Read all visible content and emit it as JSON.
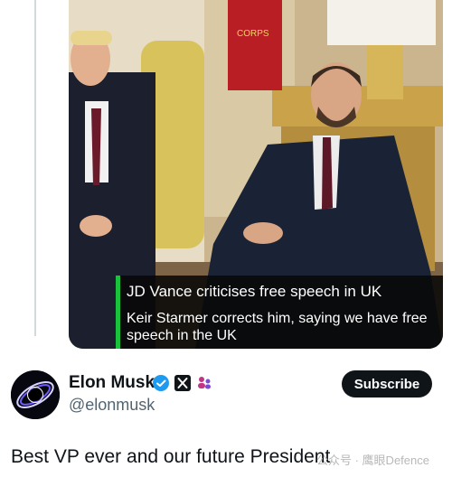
{
  "video": {
    "caption_headline": "JD Vance criticises free speech in UK",
    "caption_body": "Keir Starmer corrects him, saying we have free speech in the UK",
    "accent_color": "#19c23a"
  },
  "author": {
    "display_name": "Elon Musk",
    "handle": "@elonmusk",
    "badges": [
      "verified-check-icon",
      "x-logo-icon",
      "affiliation-people-icon"
    ],
    "verified_color": "#1d9bf0"
  },
  "actions": {
    "subscribe_label": "Subscribe"
  },
  "post": {
    "text": "Best VP ever and our future President"
  },
  "watermark": {
    "text": "公众号 · 鹰眼Defence"
  }
}
